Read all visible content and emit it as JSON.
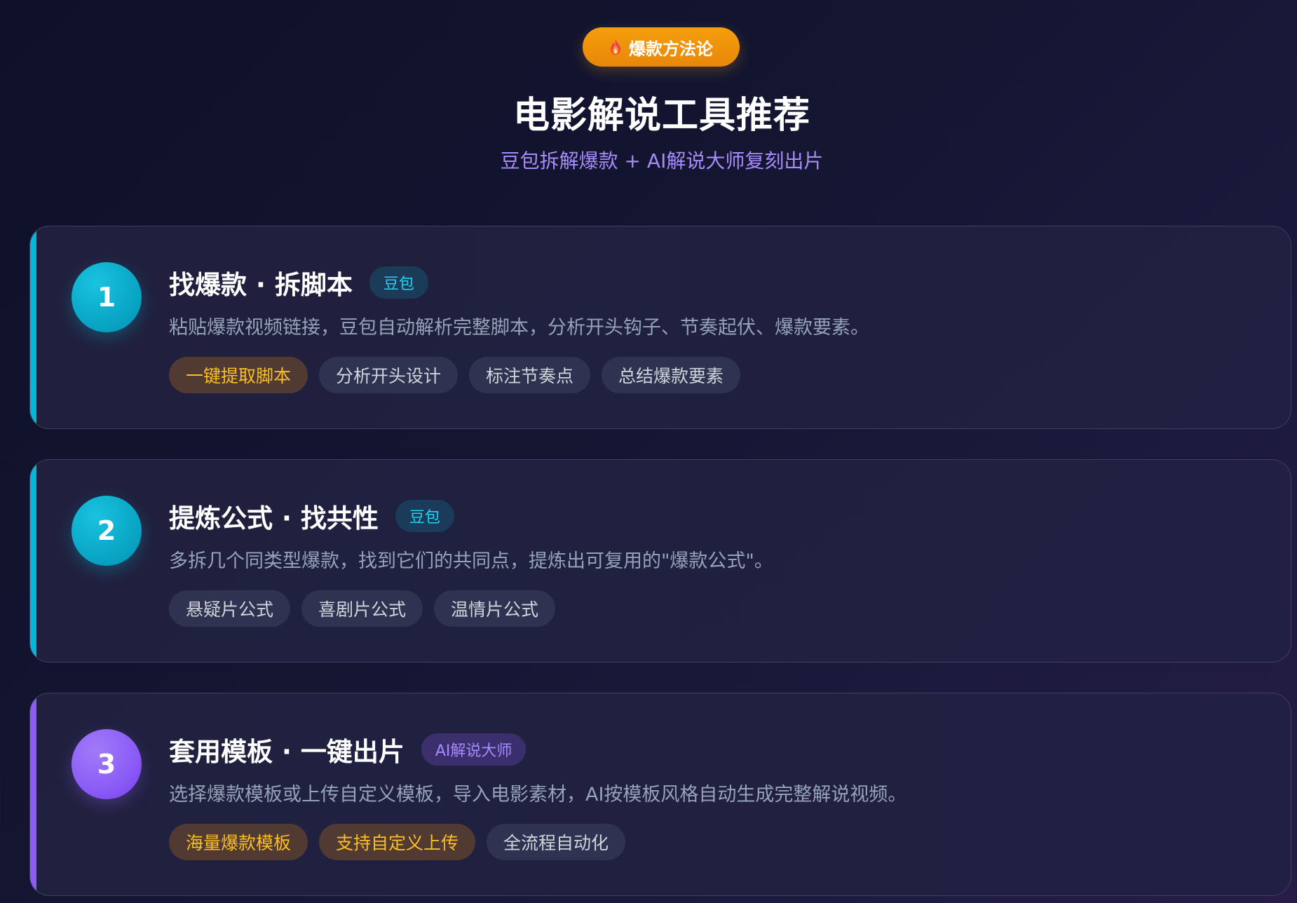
{
  "badge": {
    "icon": "flame-icon",
    "label": "爆款方法论"
  },
  "title": "电影解说工具推荐",
  "subtitle": "豆包拆解爆款 + AI解说大师复刻出片",
  "colors": {
    "cyan": "#06b6d4",
    "purple": "#8b5cf6",
    "orange": "#f59e0b",
    "chip_highlight_text": "#fbbf24"
  },
  "steps": [
    {
      "number": "1",
      "accent": "cyan",
      "title": "找爆款 · 拆脚本",
      "tool": "豆包",
      "description": "粘贴爆款视频链接，豆包自动解析完整脚本，分析开头钩子、节奏起伏、爆款要素。",
      "chips": [
        {
          "label": "一键提取脚本",
          "highlight": true
        },
        {
          "label": "分析开头设计",
          "highlight": false
        },
        {
          "label": "标注节奏点",
          "highlight": false
        },
        {
          "label": "总结爆款要素",
          "highlight": false
        }
      ]
    },
    {
      "number": "2",
      "accent": "cyan",
      "title": "提炼公式 · 找共性",
      "tool": "豆包",
      "description": "多拆几个同类型爆款，找到它们的共同点，提炼出可复用的\"爆款公式\"。",
      "chips": [
        {
          "label": "悬疑片公式",
          "highlight": false
        },
        {
          "label": "喜剧片公式",
          "highlight": false
        },
        {
          "label": "温情片公式",
          "highlight": false
        }
      ]
    },
    {
      "number": "3",
      "accent": "purple",
      "title": "套用模板 · 一键出片",
      "tool": "AI解说大师",
      "description": "选择爆款模板或上传自定义模板，导入电影素材，AI按模板风格自动生成完整解说视频。",
      "chips": [
        {
          "label": "海量爆款模板",
          "highlight": true
        },
        {
          "label": "支持自定义上传",
          "highlight": true
        },
        {
          "label": "全流程自动化",
          "highlight": false
        }
      ]
    }
  ]
}
